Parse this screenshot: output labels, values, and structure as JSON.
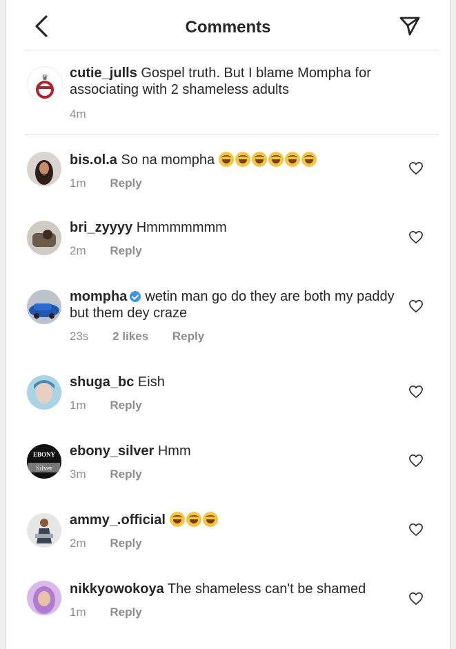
{
  "header": {
    "title": "Comments"
  },
  "caption": {
    "username": "cutie_julls",
    "text": "Gospel truth. But I blame Mompha for associating with 2 shameless adults",
    "time": "4m"
  },
  "comments": [
    {
      "username": "bis.ol.a",
      "text": "So na mompha",
      "emoji_count": 6,
      "time": "1m",
      "reply_label": "Reply",
      "avatar_color": "#3a2a22"
    },
    {
      "username": "bri_zyyyy",
      "text": "Hmmmmmmm",
      "time": "2m",
      "reply_label": "Reply",
      "avatar_color": "#5a4a3a"
    },
    {
      "username": "mompha",
      "verified": true,
      "text": "wetin man go do they are both my paddy but them dey craze",
      "time": "23s",
      "likes": "2 likes",
      "reply_label": "Reply",
      "avatar_color": "#2f5fa8"
    },
    {
      "username": "shuga_bc",
      "text": "Eish",
      "time": "1m",
      "reply_label": "Reply",
      "avatar_color": "#7ab8d8"
    },
    {
      "username": "ebony_silver",
      "text": "Hmm",
      "time": "3m",
      "reply_label": "Reply",
      "avatar_color": "#1a1a1a",
      "avatar_text_top": "EBONY",
      "avatar_text_bottom": "Silver"
    },
    {
      "username": "ammy_.official",
      "text": "",
      "emoji_count": 3,
      "time": "2m",
      "reply_label": "Reply",
      "avatar_color": "#c8c8c8"
    },
    {
      "username": "nikkyowokoya",
      "text": "The shameless can't be shamed",
      "time": "1m",
      "reply_label": "Reply",
      "avatar_color": "#b98fd0"
    }
  ]
}
